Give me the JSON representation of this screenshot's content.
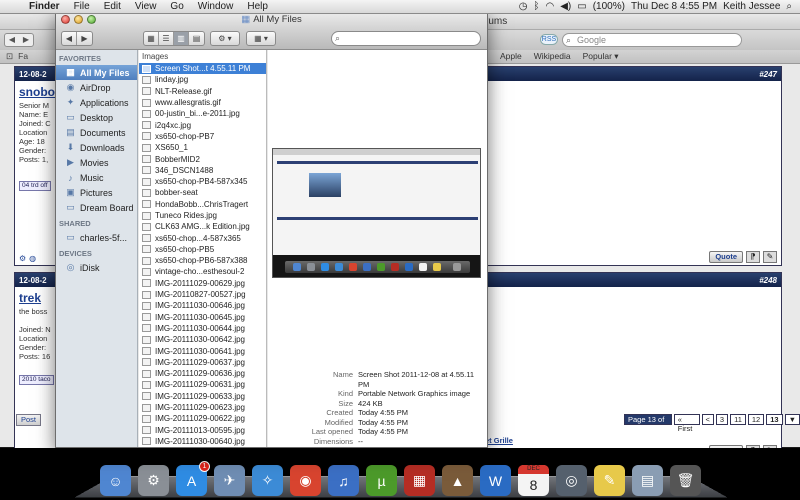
{
  "menubar": {
    "app_name": "Finder",
    "menus": [
      "File",
      "Edit",
      "View",
      "Go",
      "Window",
      "Help"
    ],
    "battery": "(100%)",
    "datetime": "Thu Dec 8  4:55 PM",
    "user": "Keith Jessee"
  },
  "browser": {
    "title_fragment": "rums",
    "rss_label": "RSS",
    "search_placeholder": "Google",
    "bookmarks_left": [
      "⊡",
      "Fa"
    ],
    "bookmarks_right": [
      "Apple",
      "Wikipedia",
      "Popular ▾"
    ],
    "posts": [
      {
        "date": "12-08-2",
        "number": "#247",
        "username": "snobo",
        "fields": [
          "Senior M",
          "Name: E",
          "Joined: C",
          "Location",
          "Age: 18",
          "Gender:",
          "Posts: 1,"
        ],
        "box": "04 trd off",
        "quote_label": "Quote"
      },
      {
        "date": "12-08-2",
        "number": "#248",
        "username": "trek",
        "fields": [
          "the boss",
          "",
          "Joined: N",
          "Location",
          "Gender:",
          "Posts: 16"
        ],
        "box": "2010 taco",
        "quote_label": "Quote"
      }
    ],
    "pager": {
      "label": "Page 13 of 13",
      "first": "« First",
      "prev": "<",
      "pages": [
        "3",
        "11",
        "12",
        "13"
      ],
      "current": "13",
      "next": "▼"
    },
    "post_reply": "Post",
    "bottom_link": "um Billet Grille"
  },
  "finder": {
    "title": "All My Files",
    "search_placeholder": "",
    "sidebar": {
      "favorites_heading": "FAVORITES",
      "favorites": [
        {
          "label": "All My Files",
          "icon": "all-files-icon",
          "glyph": "▦"
        },
        {
          "label": "AirDrop",
          "icon": "airdrop-icon",
          "glyph": "◉"
        },
        {
          "label": "Applications",
          "icon": "applications-icon",
          "glyph": "✦"
        },
        {
          "label": "Desktop",
          "icon": "desktop-icon",
          "glyph": "▭"
        },
        {
          "label": "Documents",
          "icon": "documents-icon",
          "glyph": "▤"
        },
        {
          "label": "Downloads",
          "icon": "downloads-icon",
          "glyph": "⬇"
        },
        {
          "label": "Movies",
          "icon": "movies-icon",
          "glyph": "▶"
        },
        {
          "label": "Music",
          "icon": "music-icon",
          "glyph": "♪"
        },
        {
          "label": "Pictures",
          "icon": "pictures-icon",
          "glyph": "▣"
        },
        {
          "label": "Dream Board",
          "icon": "folder-icon",
          "glyph": "▭"
        }
      ],
      "shared_heading": "SHARED",
      "shared": [
        {
          "label": "charles-5f...",
          "icon": "computer-icon",
          "glyph": "▭"
        }
      ],
      "devices_heading": "DEVICES",
      "devices": [
        {
          "label": "iDisk",
          "icon": "idisk-icon",
          "glyph": "◎"
        }
      ]
    },
    "column_heading": "Images",
    "files": [
      "Screen Shot...t 4.55.11 PM",
      "linday.jpg",
      "NLT-Release.gif",
      "www.allesgratis.gif",
      "00-justin_bi...e-2011.jpg",
      "i2q4xc.jpg",
      "xs650-chop-PB7",
      "XS650_1",
      "BobberMID2",
      "346_DSCN1488",
      "xs650-chop-PB4-587x345",
      "bobber-seat",
      "HondaBobb...ChrisTragert",
      "Tuneco Rides.jpg",
      "CLK63 AMG...k Edition.jpg",
      "xs650-chop...4-587x365",
      "xs650-chop-PB5",
      "xs650-chop-PB6-587x388",
      "vintage-cho...esthesoul-2",
      "IMG-20111029-00629.jpg",
      "IMG-20110827-00527.jpg",
      "IMG-20111030-00646.jpg",
      "IMG-20111030-00645.jpg",
      "IMG-20111030-00644.jpg",
      "IMG-20111030-00642.jpg",
      "IMG-20111030-00641.jpg",
      "IMG-20111029-00637.jpg",
      "IMG-20111029-00636.jpg",
      "IMG-20111029-00631.jpg",
      "IMG-20111029-00633.jpg",
      "IMG-20111029-00623.jpg",
      "IMG-20111029-00622.jpg",
      "IMG-20111013-00595.jpg",
      "IMG-20111030-00640.jpg"
    ],
    "selected_index": 0,
    "info": [
      {
        "key": "Name",
        "value": "Screen Shot 2011-12-08 at 4.55.11 PM"
      },
      {
        "key": "Kind",
        "value": "Portable Network Graphics image"
      },
      {
        "key": "Size",
        "value": "424 KB"
      },
      {
        "key": "Created",
        "value": "Today 4:55 PM"
      },
      {
        "key": "Modified",
        "value": "Today 4:55 PM"
      },
      {
        "key": "Last opened",
        "value": "Today 4:55 PM"
      },
      {
        "key": "Dimensions",
        "value": "--"
      }
    ]
  },
  "dock": {
    "items": [
      {
        "name": "finder-icon",
        "glyph": "☺",
        "color": "#4f86d1"
      },
      {
        "name": "system-preferences-icon",
        "glyph": "⚙",
        "color": "#8a8f96"
      },
      {
        "name": "app-store-icon",
        "glyph": "A",
        "color": "#2f8ce3",
        "badge": "1"
      },
      {
        "name": "mail-icon",
        "glyph": "✈",
        "color": "#6f8db3"
      },
      {
        "name": "safari-icon",
        "glyph": "✧",
        "color": "#3c8bd6"
      },
      {
        "name": "chrome-icon",
        "glyph": "◉",
        "color": "#d8442f"
      },
      {
        "name": "itunes-icon",
        "glyph": "♫",
        "color": "#3b6fc4"
      },
      {
        "name": "utorrent-icon",
        "glyph": "µ",
        "color": "#4c9a2a"
      },
      {
        "name": "photo-booth-icon",
        "glyph": "▦",
        "color": "#b52d24"
      },
      {
        "name": "iphoto-icon",
        "glyph": "▲",
        "color": "#7a5b3a"
      },
      {
        "name": "word-icon",
        "glyph": "W",
        "color": "#2a6bc3"
      },
      {
        "name": "calendar-icon",
        "glyph": "8",
        "color": "#f4f4f4",
        "cal_label": "DEC"
      },
      {
        "name": "screen-capture-icon",
        "glyph": "◎",
        "color": "#55606d"
      },
      {
        "name": "stickies-icon",
        "glyph": "✎",
        "color": "#e7c94a"
      },
      {
        "name": "preview-icon",
        "glyph": "▤",
        "color": "#8a9db3"
      },
      {
        "name": "trash-icon",
        "glyph": "🗑",
        "color": "#555555"
      }
    ]
  },
  "colors": {
    "selection": "#3d80d6",
    "sidebar_bg": "#dee4ea",
    "forum_header": "#14234a",
    "link": "#1d3f8f"
  }
}
